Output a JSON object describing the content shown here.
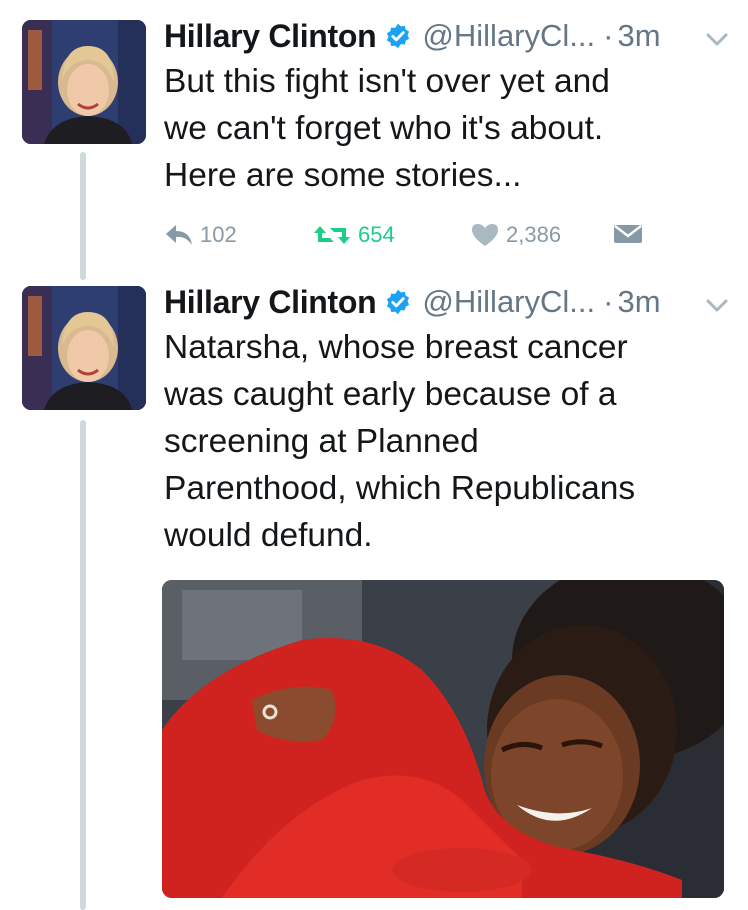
{
  "tweets": [
    {
      "author": "Hillary Clinton",
      "handle": "@HillaryCl...",
      "separator": "·",
      "time": "3m",
      "text_lines": [
        "But this fight isn't over yet and",
        "we can't forget who it's about.",
        "Here are some stories..."
      ],
      "actions": {
        "replies": "102",
        "retweets": "654",
        "likes": "2,386"
      },
      "icons": [
        "reply-icon",
        "retweet-icon",
        "heart-icon",
        "direct-message-icon",
        "verified-badge-icon",
        "chevron-down-icon"
      ]
    },
    {
      "author": "Hillary Clinton",
      "handle": "@HillaryCl...",
      "separator": "·",
      "time": "3m",
      "text_lines": [
        "Natarsha, whose breast cancer",
        "was caught early because of a",
        "screening at Planned",
        "Parenthood, which Republicans",
        "would defund."
      ],
      "icons": [
        "verified-badge-icon",
        "chevron-down-icon"
      ]
    }
  ],
  "colors": {
    "text": "#14171a",
    "muted": "#657786",
    "action_gray": "#8899a6",
    "retweet_green": "#19cf86",
    "verified_blue": "#1da1f2",
    "thread_line": "#cfd9de"
  }
}
